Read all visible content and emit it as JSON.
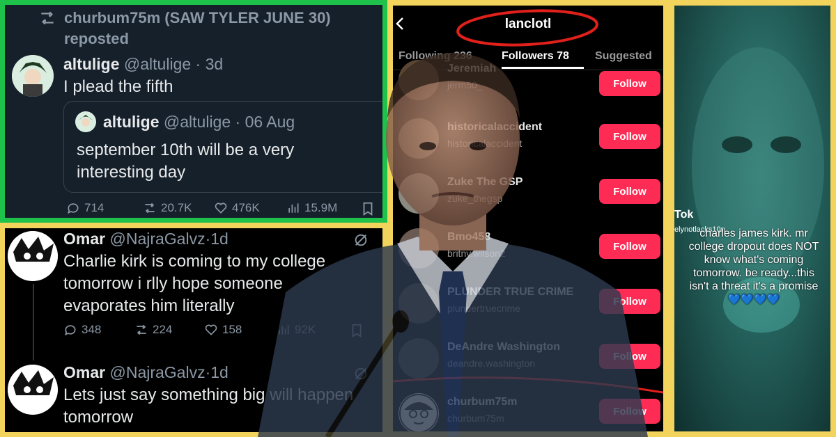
{
  "panel1": {
    "repost_user": "churbum75m (SAW TYLER JUNE 30)",
    "repost_label": "reposted",
    "author": "altulige",
    "handle": "@altulige",
    "time": "3d",
    "text": "I plead the fifth",
    "quote": {
      "author": "altulige",
      "handle": "@altulige",
      "time": "06 Aug",
      "text_line1": "september 10th will be a very",
      "text_line2": "interesting day"
    },
    "stats": {
      "replies": "714",
      "reposts": "20.7K",
      "likes": "476K",
      "views": "15.9M"
    }
  },
  "panel2": {
    "tweets": [
      {
        "author": "Omar",
        "handle": "@NajraGalvz",
        "time": "1d",
        "line1": "Charlie kirk is coming to my college",
        "line2": "tomorrow i rlly hope someone",
        "line3": "evaporates him literally",
        "replies": "348",
        "reposts": "224",
        "likes": "158",
        "views": "92K"
      },
      {
        "author": "Omar",
        "handle": "@NajraGalvz",
        "time": "1d",
        "line1": "Lets just say something big will happen",
        "line2": "tomorrow"
      }
    ]
  },
  "panel3": {
    "username": "lanclotl",
    "tabs": [
      "Following 236",
      "Followers 78",
      "Suggested"
    ],
    "active_tab": "Followers 78",
    "follow_label": "Follow",
    "rows": [
      {
        "name": "Jeremiah",
        "handle": "jerm50_"
      },
      {
        "name": "historicalaccident",
        "handle": "historicalaccident"
      },
      {
        "name": "Zuke The GSP",
        "handle": "zuke_thegsp"
      },
      {
        "name": "Bmo458",
        "handle": "britny.wilson2"
      },
      {
        "name": "PLUNDER TRUE CRIME",
        "handle": "plundertruecrime"
      },
      {
        "name": "DeAndre Washington",
        "handle": "deandre.washington"
      },
      {
        "name": "churbum75m",
        "handle": "churbum75m"
      }
    ],
    "highlight_color": "#e0201b"
  },
  "panel4": {
    "app_label": "Tok",
    "username_partial": "elynotlacks10n",
    "caption_line1": "charles james kirk. mr",
    "caption_line2": "college dropout does NOT",
    "caption_line3": "know what's coming",
    "caption_line4": "tomorrow. be ready...this",
    "caption_line5": "isn't a threat it's a promise",
    "emoji": "💙💙💙💙"
  },
  "colors": {
    "frame_yellow": "#f2d45c",
    "frame_green": "#1ec24a",
    "follow_red": "#fe2c55",
    "twitter_bg": "#15202b"
  }
}
